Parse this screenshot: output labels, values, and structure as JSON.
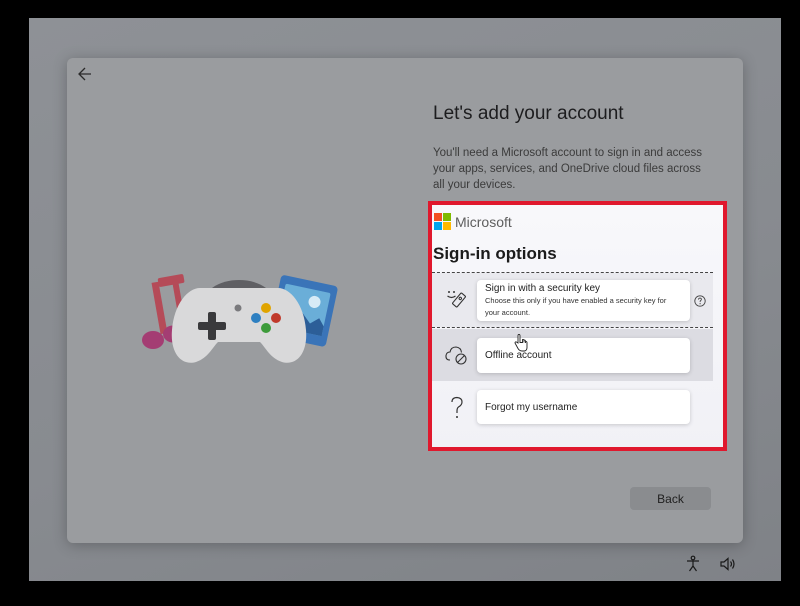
{
  "window": {
    "nav": {
      "back_icon": "arrow-left-icon"
    }
  },
  "setup": {
    "title": "Let's add your account",
    "description": "You'll need a Microsoft account to sign in and access your apps, services, and OneDrive cloud files across all your devices.",
    "back_button_label": "Back"
  },
  "signin": {
    "brand": "Microsoft",
    "heading": "Sign-in options",
    "options": [
      {
        "label": "Sign in with a security key",
        "sublabel": "Choose this only if you have enabled a security key for your account.",
        "icon": "security-key-icon",
        "selected": true
      },
      {
        "label": "Offline account",
        "icon": "offline-cloud-icon",
        "hovered": true
      },
      {
        "label": "Forgot my username",
        "icon": "question-mark-icon"
      }
    ],
    "help_icon": "help-circle-icon"
  },
  "footer": {
    "icons": [
      "accessibility-icon",
      "volume-icon"
    ]
  },
  "colors": {
    "highlight_border": "#e0182d",
    "ms_red": "#f25022",
    "ms_green": "#7fba00",
    "ms_blue": "#00a4ef",
    "ms_yellow": "#ffb900"
  }
}
